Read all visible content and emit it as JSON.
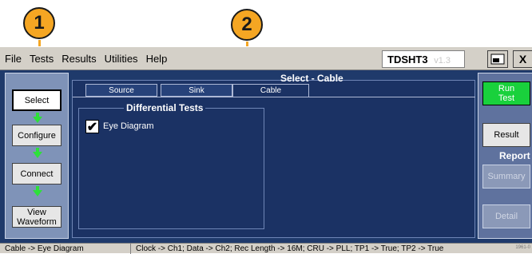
{
  "callouts": [
    "1",
    "2"
  ],
  "menu": [
    "File",
    "Tests",
    "Results",
    "Utilities",
    "Help"
  ],
  "app": {
    "name": "TDSHT3",
    "version": "v1.3",
    "close_glyph": "X"
  },
  "title": "Select - Cable",
  "tabs": [
    "Source",
    "Sink",
    "Cable"
  ],
  "active_tab": "Cable",
  "nav": [
    "Select",
    "Configure",
    "Connect",
    "View\nWaveform"
  ],
  "group": {
    "title": "Differential Tests",
    "items": [
      {
        "label": "Eye Diagram",
        "checked": true
      }
    ]
  },
  "right": {
    "run": "Run\nTest",
    "result": "Result",
    "report": "Report",
    "summary": "Summary",
    "detail": "Detail"
  },
  "status": {
    "left": "Cable -> Eye Diagram",
    "right": "Clock -> Ch1; Data -> Ch2; Rec Length -> 16M; CRU -> PLL; TP1 -> True; TP2 -> True"
  },
  "figure_id": "1961-0",
  "colors": {
    "panel": "#1f3a6b",
    "callout": "#f5a623",
    "run": "#19d13c"
  }
}
